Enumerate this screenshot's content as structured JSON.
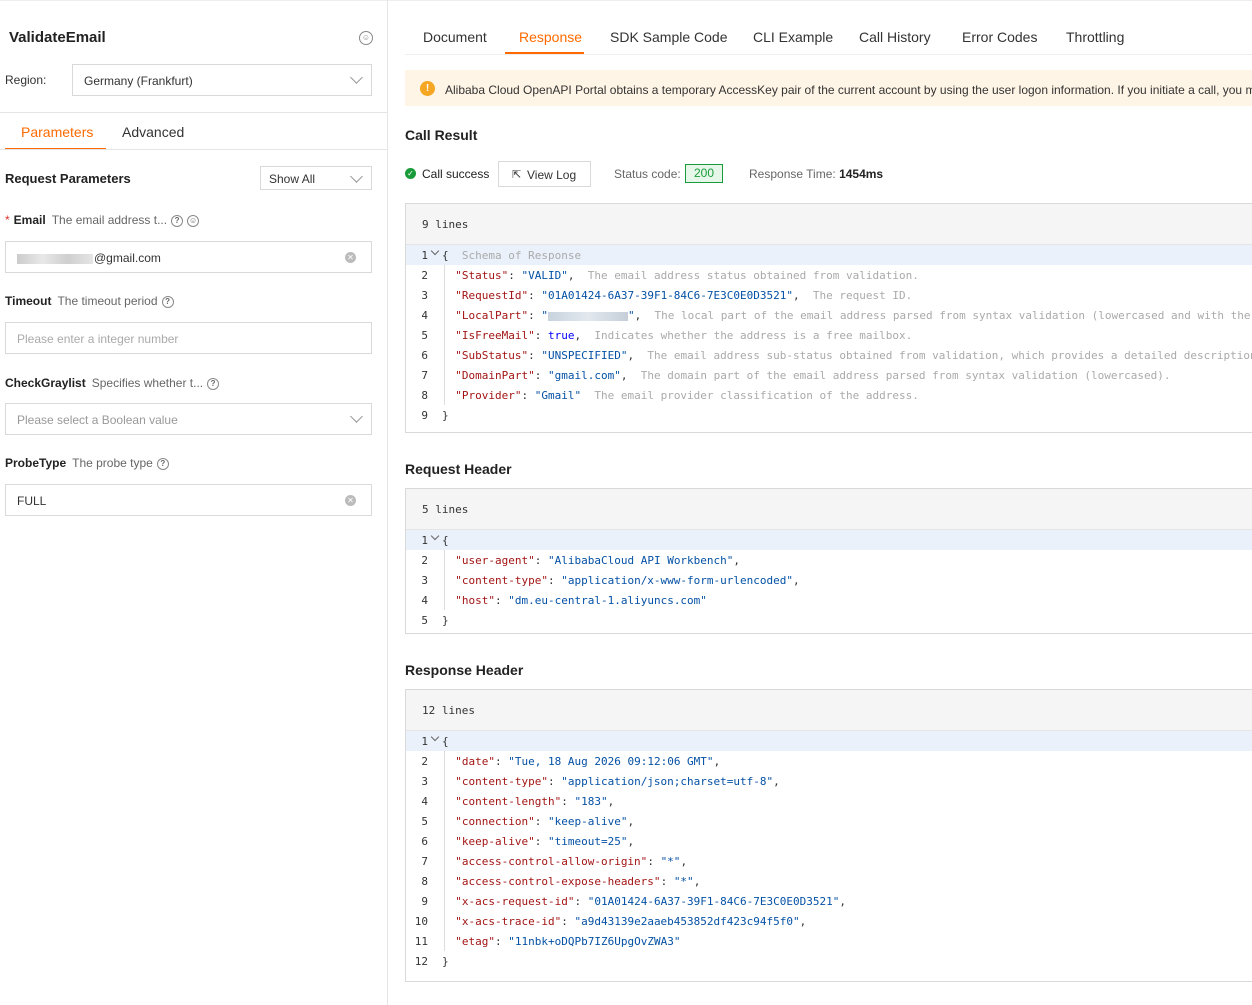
{
  "left": {
    "api_title": "ValidateEmail",
    "region_label": "Region:",
    "region_value": "Germany (Frankfurt)",
    "tabs": [
      {
        "label": "Parameters"
      },
      {
        "label": "Advanced"
      }
    ],
    "section_title": "Request Parameters",
    "show_all": "Show All",
    "fields": {
      "email": {
        "label": "Email",
        "required": "*",
        "desc": "The email address t...",
        "value_suffix": "@gmail.com"
      },
      "timeout": {
        "label": "Timeout",
        "desc": "The timeout period",
        "placeholder": "Please enter a integer number"
      },
      "checkgraylist": {
        "label": "CheckGraylist",
        "desc": "Specifies whether t...",
        "placeholder": "Please select a Boolean value"
      },
      "probetype": {
        "label": "ProbeType",
        "desc": "The probe type",
        "value": "FULL"
      }
    }
  },
  "right": {
    "tabs": [
      {
        "label": "Document"
      },
      {
        "label": "Response"
      },
      {
        "label": "SDK Sample Code"
      },
      {
        "label": "CLI Example"
      },
      {
        "label": "Call History"
      },
      {
        "label": "Error Codes"
      },
      {
        "label": "Throttling"
      }
    ],
    "active_tab": "Response",
    "notice": "Alibaba Cloud OpenAPI Portal obtains a temporary AccessKey pair of the current account by using the user logon information. If you initiate a call, you m",
    "call_result_title": "Call Result",
    "call_success": "Call success",
    "view_log": "View Log",
    "status_label": "Status code:",
    "status_code": "200",
    "response_time_label": "Response Time:",
    "response_time_value": "1454ms",
    "response_body": {
      "lines_label": "9 lines",
      "schema_comment": "Schema of Response",
      "fields": [
        {
          "key": "\"Status\"",
          "value": "\"VALID\"",
          "comment": "The email address status obtained from validation."
        },
        {
          "key": "\"RequestId\"",
          "value": "\"01A01424-6A37-39F1-84C6-7E3C0E0D3521\"",
          "comment": "The request ID."
        },
        {
          "key": "\"LocalPart\"",
          "value": "\"",
          "value_end": "\"",
          "comment": "The local part of the email address parsed from syntax validation (lowercased and with the p"
        },
        {
          "key": "\"IsFreeMail\"",
          "value": "true",
          "comment": "Indicates whether the address is a free mailbox."
        },
        {
          "key": "\"SubStatus\"",
          "value": "\"UNSPECIFIED\"",
          "comment": "The email address sub-status obtained from validation, which provides a detailed description"
        },
        {
          "key": "\"DomainPart\"",
          "value": "\"gmail.com\"",
          "comment": "The domain part of the email address parsed from syntax validation (lowercased)."
        },
        {
          "key": "\"Provider\"",
          "value": "\"Gmail\"",
          "comment": "The email provider classification of the address."
        }
      ]
    },
    "request_header_title": "Request Header",
    "request_header": {
      "lines_label": "5 lines",
      "fields": [
        {
          "key": "\"user-agent\"",
          "value": "\"AlibabaCloud API Workbench\""
        },
        {
          "key": "\"content-type\"",
          "value": "\"application/x-www-form-urlencoded\""
        },
        {
          "key": "\"host\"",
          "value": "\"dm.eu-central-1.aliyuncs.com\""
        }
      ]
    },
    "response_header_title": "Response Header",
    "response_header": {
      "lines_label": "12 lines",
      "fields": [
        {
          "key": "\"date\"",
          "value": "\"Tue, 18 Aug 2026 09:12:06 GMT\""
        },
        {
          "key": "\"content-type\"",
          "value": "\"application/json;charset=utf-8\""
        },
        {
          "key": "\"content-length\"",
          "value": "\"183\""
        },
        {
          "key": "\"connection\"",
          "value": "\"keep-alive\""
        },
        {
          "key": "\"keep-alive\"",
          "value": "\"timeout=25\""
        },
        {
          "key": "\"access-control-allow-origin\"",
          "value": "\"*\""
        },
        {
          "key": "\"access-control-expose-headers\"",
          "value": "\"*\""
        },
        {
          "key": "\"x-acs-request-id\"",
          "value": "\"01A01424-6A37-39F1-84C6-7E3C0E0D3521\""
        },
        {
          "key": "\"x-acs-trace-id\"",
          "value": "\"a9d43139e2aaeb453852df423c94f5f0\""
        },
        {
          "key": "\"etag\"",
          "value": "\"11nbk+oDQPb7IZ6UpgOvZWA3\""
        }
      ]
    }
  },
  "colors": {
    "accent": "#ff6a00",
    "success": "#1a9b3a",
    "warning": "#f5a623"
  },
  "icons": [
    "feedback-icon",
    "chevron-down-icon",
    "help-icon",
    "clear-icon",
    "warning-icon",
    "check-circle-icon",
    "external-link-icon",
    "fold-icon"
  ]
}
